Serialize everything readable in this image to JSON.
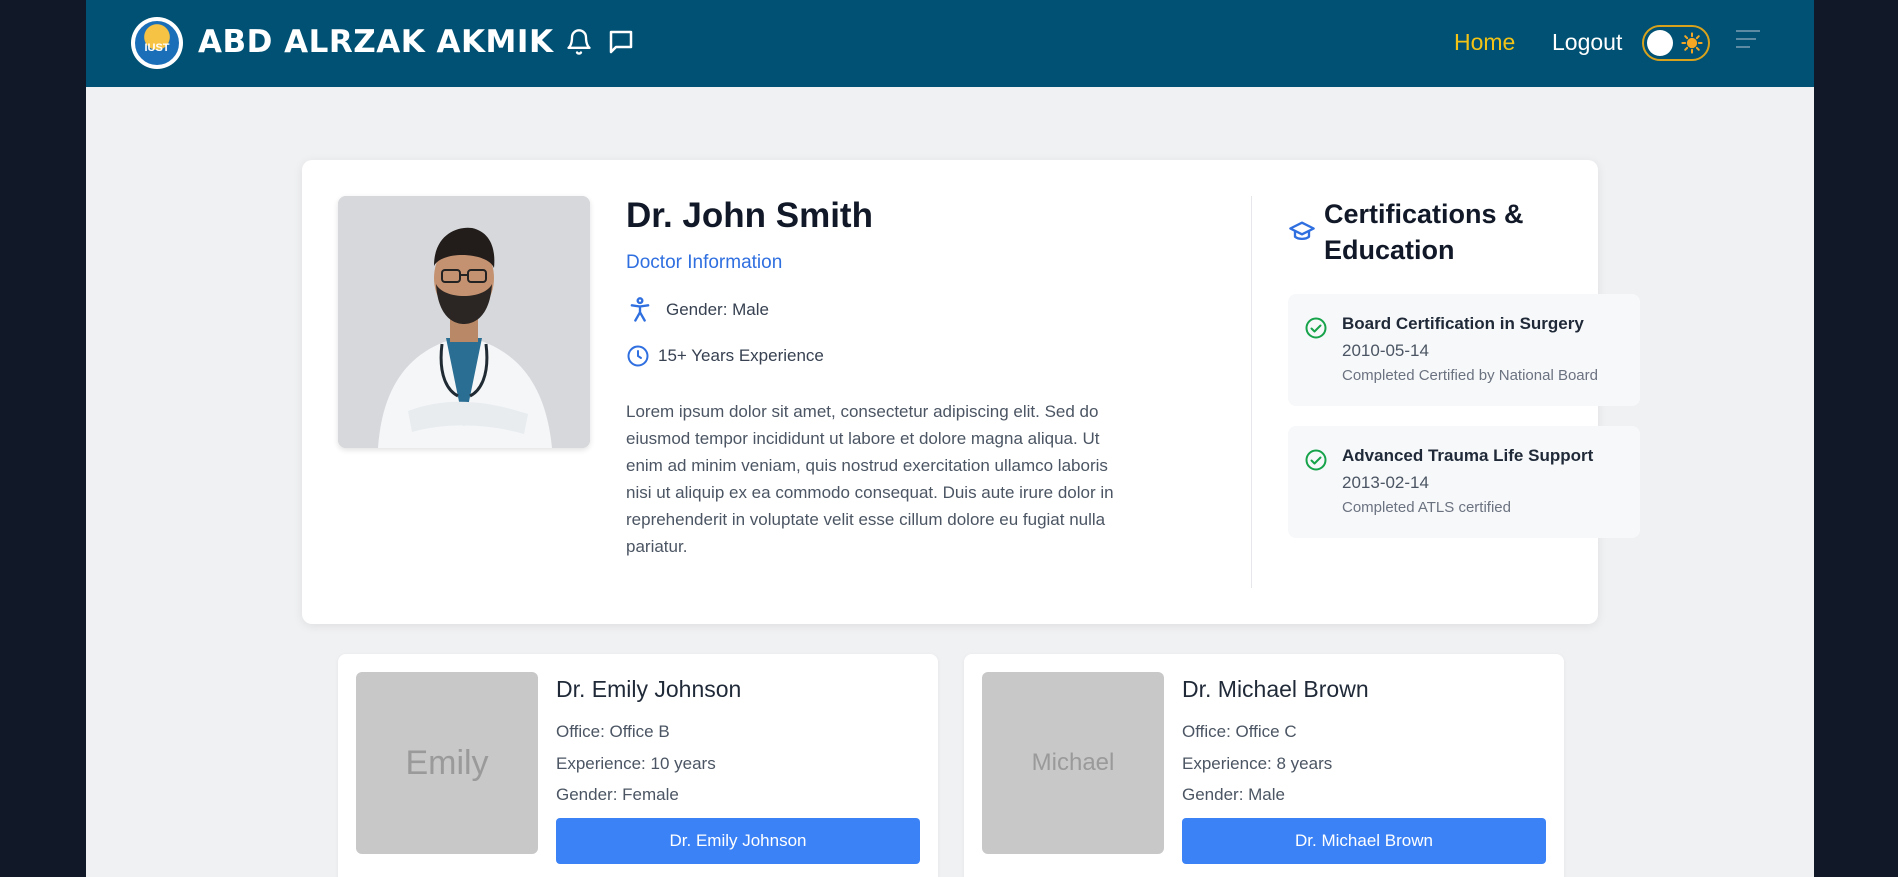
{
  "header": {
    "brand": "ABD ALRZAK AKMIK",
    "logo_text": "IUST",
    "nav": {
      "home": "Home",
      "logout": "Logout"
    },
    "icons": [
      "bell-icon",
      "chat-icon",
      "sun-icon",
      "menu-icon"
    ],
    "colors": {
      "bar": "#005173",
      "active_link": "#f2c316"
    }
  },
  "profile": {
    "name": "Dr. John Smith",
    "subtitle": "Doctor Information",
    "gender": "Gender: Male",
    "experience": "15+ Years Experience",
    "bio": "Lorem ipsum dolor sit amet, consectetur adipiscing elit. Sed do eiusmod tempor incididunt ut labore et dolore magna aliqua. Ut enim ad minim veniam, quis nostrud exercitation ullamco laboris nisi ut aliquip ex ea commodo consequat. Duis aute irure dolor in reprehenderit in voluptate velit esse cillum dolore eu fugiat nulla pariatur."
  },
  "certifications": {
    "title": "Certifications & Education",
    "items": [
      {
        "name": "Board Certification in Surgery",
        "date": "2010-05-14",
        "desc": "Completed Certified by National Board"
      },
      {
        "name": "Advanced Trauma Life Support",
        "date": "2013-02-14",
        "desc": "Completed ATLS certified"
      }
    ]
  },
  "doctors": [
    {
      "thumb": "Emily",
      "name": "Dr. Emily Johnson",
      "office": "Office: Office B",
      "experience": "Experience: 10 years",
      "gender": "Gender: Female",
      "button": "Dr. Emily Johnson"
    },
    {
      "thumb": "Michael",
      "name": "Dr. Michael Brown",
      "office": "Office: Office C",
      "experience": "Experience: 8 years",
      "gender": "Gender: Male",
      "button": "Dr. Michael Brown"
    }
  ]
}
